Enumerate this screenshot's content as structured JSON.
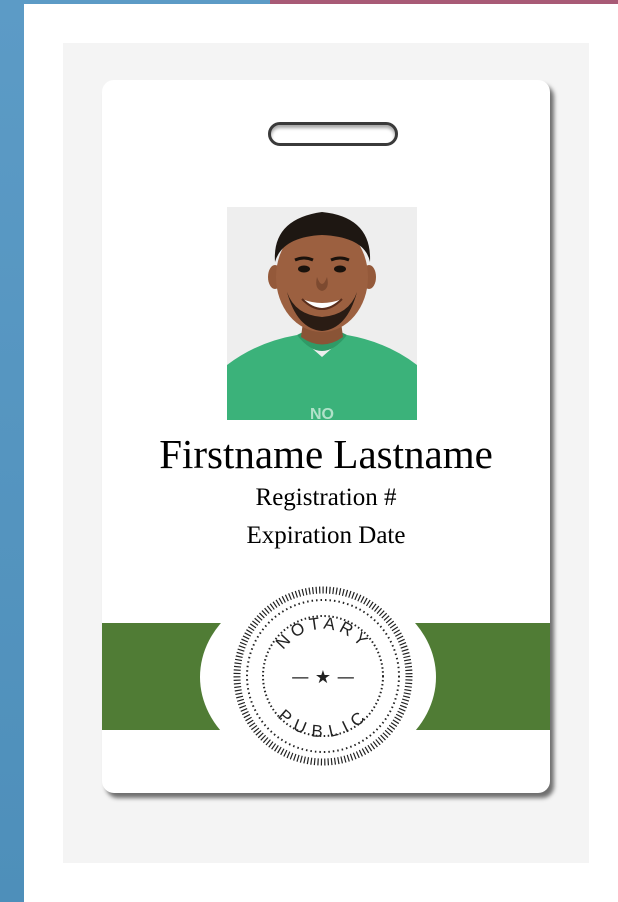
{
  "badge": {
    "name": "Firstname Lastname",
    "registration": "Registration #",
    "expiration": "Expiration Date"
  },
  "seal": {
    "top_text": "NOTARY",
    "bottom_text": "PUBLIC",
    "center_glyph": "— ★ —"
  },
  "colors": {
    "accent_band": "#507c35",
    "shirt": "#3bb27a",
    "left_strip": "#5c9bc6",
    "top_strip_right": "#a85a76"
  }
}
